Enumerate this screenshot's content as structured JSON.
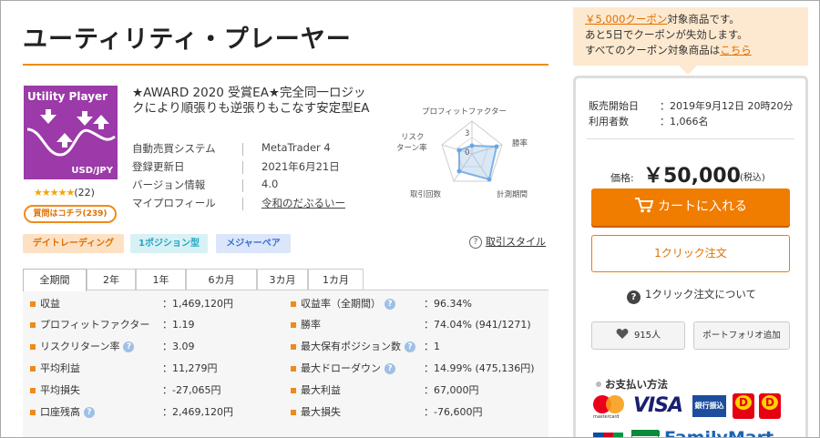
{
  "title": "ユーティリティ・プレーヤー",
  "logo": {
    "title": "Utility Player",
    "pair": "USD/JPY"
  },
  "rating": {
    "stars": "★★★★★",
    "count": "(22)"
  },
  "question_button": "質問はコチラ(239)",
  "headline": "★AWARD 2020 受賞EA★完全同一ロジックにより順張りも逆張りもこなす安定型EA",
  "specs": [
    {
      "key": "自動売買システム",
      "value": "MetaTrader 4"
    },
    {
      "key": "登録更新日",
      "value": "2021年6月21日"
    },
    {
      "key": "バージョン情報",
      "value": "4.0"
    },
    {
      "key": "マイプロフィール",
      "value": "令和のだぶるいー"
    }
  ],
  "radar": {
    "labels": {
      "profit_factor": "プロフィットファクター",
      "win_rate": "勝率",
      "period": "計測期間",
      "trades": "取引回数",
      "risk_return_line1": "リスク",
      "risk_return_line2": "ターン率"
    },
    "scale_label": "3",
    "center_label": "0"
  },
  "tags": [
    "デイトレーディング",
    "1ポジション型",
    "メジャーペア"
  ],
  "style_link": "取引スタイル",
  "tabs": [
    "全期間",
    "2年",
    "1年",
    "6カ月",
    "3カ月",
    "1カ月"
  ],
  "stats_left": [
    {
      "key": "収益",
      "value": "：1,469,120円",
      "help": false
    },
    {
      "key": "プロフィットファクター",
      "value": "：1.19",
      "help": false
    },
    {
      "key": "リスクリターン率",
      "value": "：3.09",
      "help": true
    },
    {
      "key": "平均利益",
      "value": "：11,279円",
      "help": false
    },
    {
      "key": "平均損失",
      "value": "：-27,065円",
      "help": false
    },
    {
      "key": "口座残高",
      "value": "：2,469,120円",
      "help": true
    }
  ],
  "stats_right": [
    {
      "key": "収益率（全期間）",
      "value": "：96.34%",
      "help": true
    },
    {
      "key": "勝率",
      "value": "：74.04% (941/1271)",
      "help": false
    },
    {
      "key": "最大保有ポジション数",
      "value": "：1",
      "help": true
    },
    {
      "key": "最大ドローダウン",
      "value": "：14.99% (475,136円)",
      "help": true
    },
    {
      "key": "最大利益",
      "value": "：67,000円",
      "help": false
    },
    {
      "key": "最大損失",
      "value": "：-76,600円",
      "help": false
    }
  ],
  "coupon": {
    "link": "￥5,000クーポン",
    "line1_rest": "対象商品です。",
    "line2": "あと5日でクーポンが失効します。",
    "line3": "すべてのクーポン対象商品は",
    "line3_link": "こちら"
  },
  "side": {
    "sale_start_label": "販売開始日",
    "sale_start_value": "：2019年9月12日 20時20分",
    "users_label": "利用者数",
    "users_value": "：1,066名",
    "price_label": "価格:",
    "price": "￥50,000",
    "price_tax": "(税込)",
    "cart_button": "カートに入れる",
    "one_click_button": "1クリック注文",
    "about_one_click": "1クリック注文について",
    "favorites": "915人",
    "portfolio_add": "ポートフォリオ追加",
    "payment_title": "お支払い方法"
  },
  "payment": {
    "mastercard": "mastercard",
    "visa": "VISA",
    "bank": "銀行振込",
    "dyen1": "D",
    "dyen2": "D",
    "familymart": "FamilyMart",
    "jcb": [
      "J",
      "C",
      "B"
    ]
  },
  "colors": {
    "accent": "#f08a1a",
    "cta": "#f07c00",
    "logo_bg": "#9b3aa8"
  }
}
